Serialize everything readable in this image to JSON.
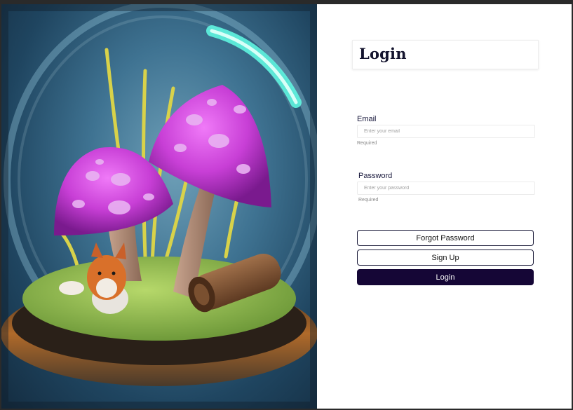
{
  "login": {
    "title": "Login",
    "email": {
      "label": "Email",
      "placeholder": "Enter your email",
      "helper": "Required"
    },
    "password": {
      "label": "Password",
      "placeholder": "Enter your password",
      "helper": "Required"
    },
    "buttons": {
      "forgot": "Forgot Password",
      "signup": "Sign Up",
      "login": "Login"
    }
  },
  "illustration": {
    "subject": "terrarium-mushrooms-fox"
  },
  "colors": {
    "primary": "#150636",
    "mushroom": "#c43fd6",
    "glass_glow": "#5ff5e0"
  }
}
